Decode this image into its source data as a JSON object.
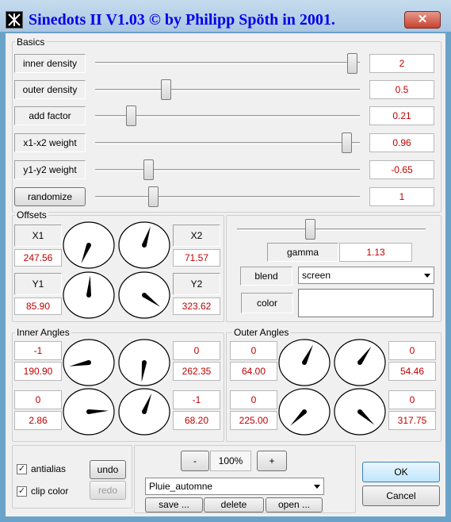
{
  "window": {
    "title": "Sinedots II V1.03 © by Philipp Spöth in 2001.",
    "icon": "sinedots-app-icon",
    "close_glyph": "✕"
  },
  "basics": {
    "label": "Basics",
    "rows": [
      {
        "label": "inner density",
        "value": "2",
        "slider_pos": 0.99
      },
      {
        "label": "outer density",
        "value": "0.5",
        "slider_pos": 0.26
      },
      {
        "label": "add factor",
        "value": "0.21",
        "slider_pos": 0.12
      },
      {
        "label": "x1-x2 weight",
        "value": "0.96",
        "slider_pos": 0.97
      },
      {
        "label": "y1-y2 weight",
        "value": "-0.65",
        "slider_pos": 0.19
      },
      {
        "label": "randomize",
        "value": "1",
        "slider_pos": 0.21
      }
    ]
  },
  "offsets": {
    "label": "Offsets",
    "x1": {
      "label": "X1",
      "value": "247.56"
    },
    "x2": {
      "label": "X2",
      "value": "71.57"
    },
    "y1": {
      "label": "Y1",
      "value": "85.90"
    },
    "y2": {
      "label": "Y2",
      "value": "323.62"
    },
    "dials": [
      {
        "angle_deg": 247.56
      },
      {
        "angle_deg": 71.57
      },
      {
        "angle_deg": 85.9
      },
      {
        "angle_deg": 323.62
      }
    ]
  },
  "gamma": {
    "label": "gamma",
    "value": "1.13",
    "slider_pos": 0.38
  },
  "blend": {
    "label": "blend",
    "selected": "screen"
  },
  "color": {
    "label": "color",
    "swatch": "#ffffff"
  },
  "inner_angles": {
    "label": "Inner Angles",
    "top_left": {
      "count": "-1",
      "value": "190.90"
    },
    "top_right": {
      "count": "0",
      "value": "262.35"
    },
    "bottom_left": {
      "count": "0",
      "value": "2.86"
    },
    "bottom_right": {
      "count": "-1",
      "value": "68.20"
    },
    "dials": [
      {
        "angle_deg": 190.9
      },
      {
        "angle_deg": 262.35
      },
      {
        "angle_deg": 2.86
      },
      {
        "angle_deg": 68.2
      }
    ]
  },
  "outer_angles": {
    "label": "Outer Angles",
    "top_left": {
      "count": "0",
      "value": "64.00"
    },
    "top_right": {
      "count": "0",
      "value": "54.46"
    },
    "bottom_left": {
      "count": "0",
      "value": "225.00"
    },
    "bottom_right": {
      "count": "0",
      "value": "317.75"
    },
    "dials": [
      {
        "angle_deg": 64.0
      },
      {
        "angle_deg": 54.46
      },
      {
        "angle_deg": 225.0
      },
      {
        "angle_deg": 317.75
      }
    ]
  },
  "options": {
    "antialias": {
      "label": "antialias",
      "checked": true
    },
    "clip_color": {
      "label": "clip color",
      "checked": true
    }
  },
  "history": {
    "undo": "undo",
    "redo": "redo"
  },
  "zoom": {
    "minus": "-",
    "value": "100%",
    "plus": "+"
  },
  "preset": {
    "selected": "Pluie_automne",
    "save": "save ...",
    "delete": "delete",
    "open": "open ..."
  },
  "dialog": {
    "ok": "OK",
    "cancel": "Cancel"
  },
  "colors": {
    "value_text": "#c00000",
    "title_text": "#0000ee"
  }
}
